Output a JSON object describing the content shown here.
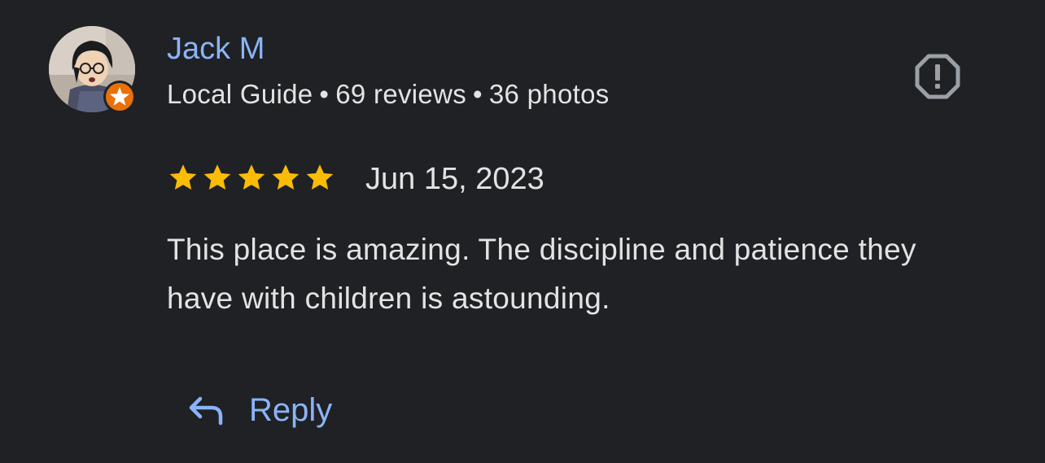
{
  "review": {
    "author": {
      "name": "Jack M",
      "guide_label": "Local Guide",
      "separator": "•",
      "reviews": "69 reviews",
      "photos": "36 photos"
    },
    "rating": 5,
    "date": "Jun 15, 2023",
    "text": "This place is amazing. The discipline and patience they have with children is astounding.",
    "reply_label": "Reply"
  },
  "icons": {
    "report": "report-octagon-icon",
    "star": "star-icon",
    "reply": "reply-arrow-icon",
    "guide_badge": "local-guide-star-badge-icon"
  },
  "colors": {
    "background": "#202124",
    "link": "#8ab4f8",
    "text": "#e3e3e3",
    "star": "#fbbc04",
    "icon_gray": "#9aa0a6",
    "badge": "#e8710a"
  }
}
